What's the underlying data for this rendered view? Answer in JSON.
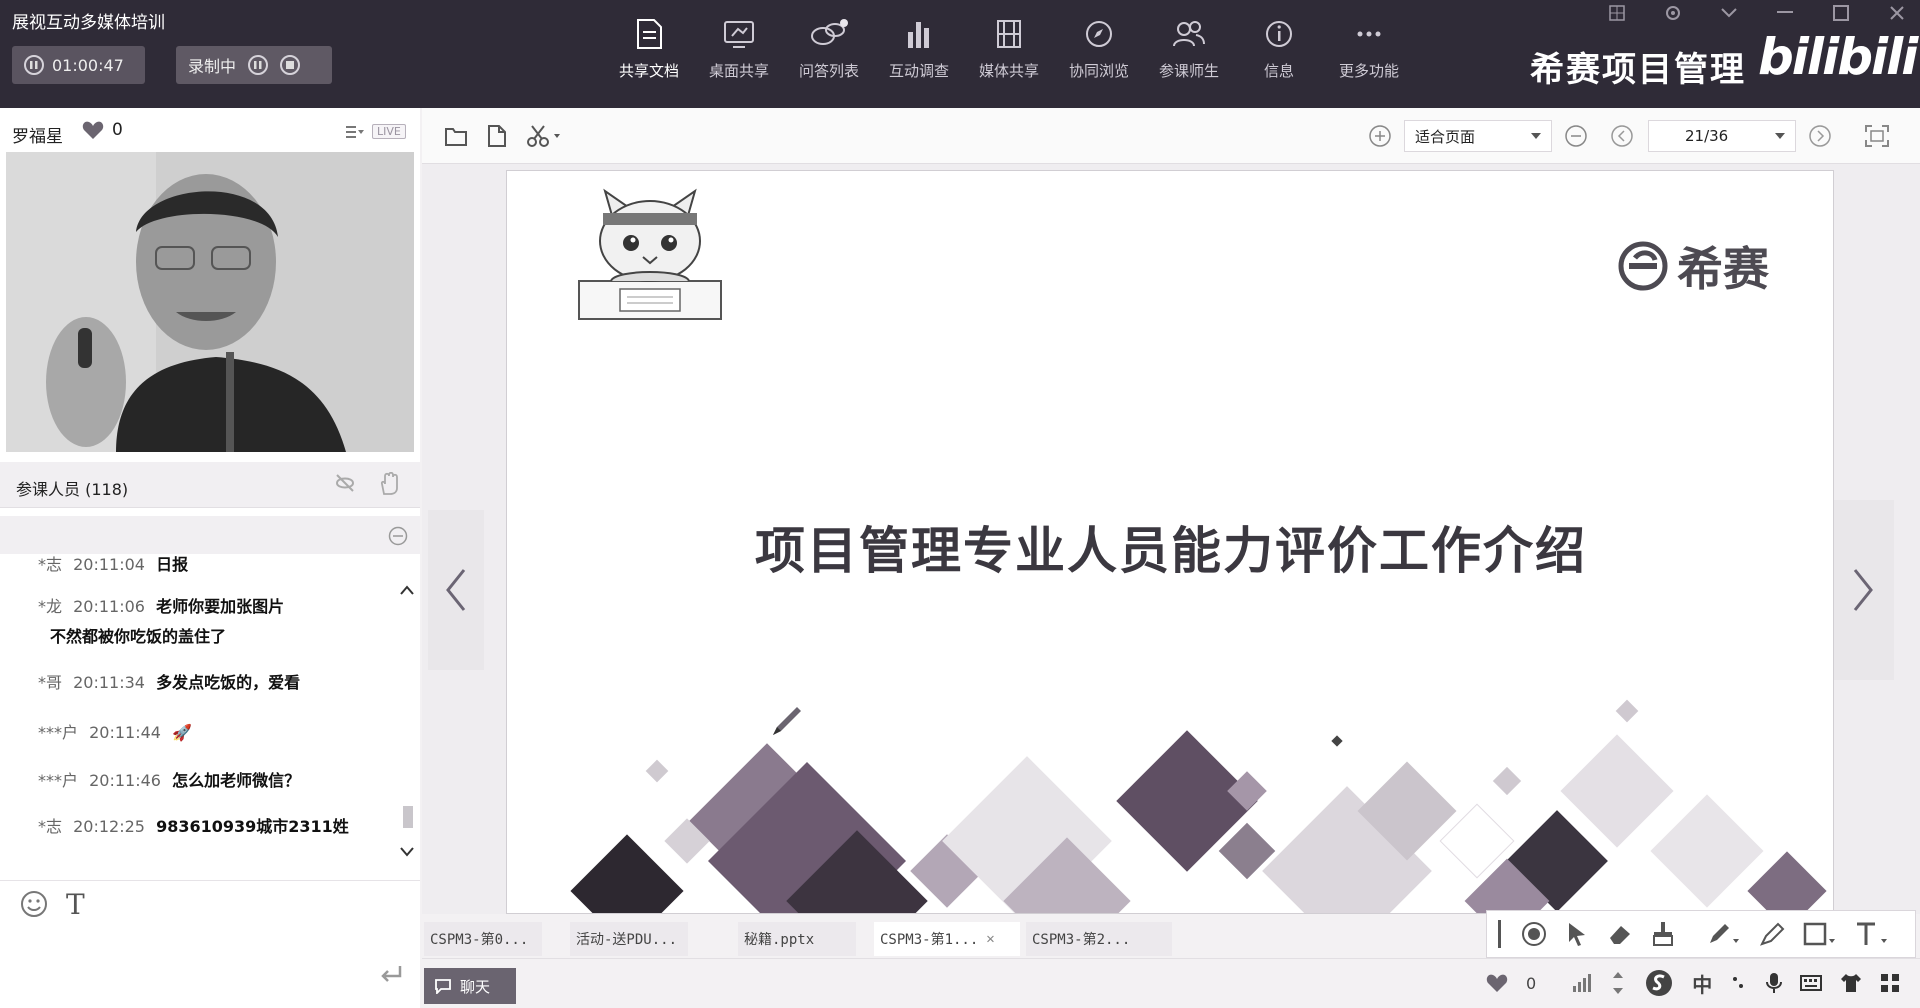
{
  "app": {
    "title": "展视互动多媒体培训",
    "timer": "01:00:47",
    "recording_label": "录制中"
  },
  "toolbar": {
    "items": [
      {
        "label": "共享文档",
        "icon": "document-share-icon"
      },
      {
        "label": "桌面共享",
        "icon": "desktop-share-icon"
      },
      {
        "label": "问答列表",
        "icon": "qa-list-icon"
      },
      {
        "label": "互动调查",
        "icon": "poll-icon"
      },
      {
        "label": "媒体共享",
        "icon": "media-share-icon"
      },
      {
        "label": "协同浏览",
        "icon": "cobrowse-icon"
      },
      {
        "label": "参课师生",
        "icon": "participants-icon"
      },
      {
        "label": "信息",
        "icon": "info-icon"
      },
      {
        "label": "更多功能",
        "icon": "more-icon"
      }
    ],
    "brand": "希赛项目管理",
    "watermark": "bilibili"
  },
  "host": {
    "name": "罗福星",
    "likes": "0",
    "live_badge": "LIVE"
  },
  "participants": {
    "label": "参课人员 (118)"
  },
  "chat": {
    "messages": [
      {
        "user": "*志",
        "time": "20:11:04",
        "text": "日报"
      },
      {
        "user": "*龙",
        "time": "20:11:06",
        "text": "老师你要加张图片",
        "text2": "不然都被你吃饭的盖住了"
      },
      {
        "user": "*哥",
        "time": "20:11:34",
        "text": "多发点吃饭的，爱看"
      },
      {
        "user": "***户",
        "time": "20:11:44",
        "text": "🚀"
      },
      {
        "user": "***户",
        "time": "20:11:46",
        "text": "怎么加老师微信？"
      },
      {
        "user": "*志",
        "time": "20:12:25",
        "text": "983610939城市2311姓"
      }
    ],
    "input_format_label": "T"
  },
  "doc": {
    "zoom_mode": "适合页面",
    "page": "21/36",
    "slide_title": "项目管理专业人员能力评价工作介绍",
    "slide_logo_text": "希赛",
    "tabs": [
      {
        "label": "CSPM3-第0..."
      },
      {
        "label": "活动-送PDU..."
      },
      {
        "label": "秘籍.pptx"
      },
      {
        "label": "CSPM3-第1...",
        "active": true
      },
      {
        "label": "CSPM3-第2..."
      }
    ]
  },
  "bottom": {
    "chat_tab": "聊天",
    "likes": "0",
    "ime": "中"
  }
}
